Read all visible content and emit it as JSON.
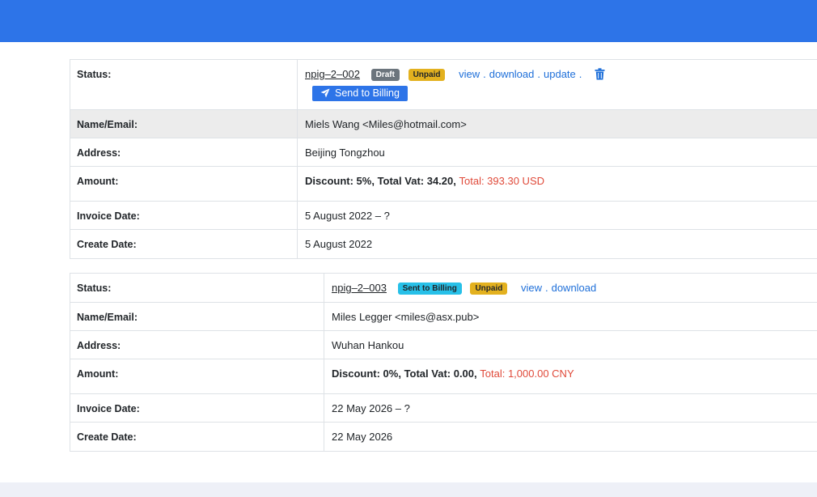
{
  "invoices": [
    {
      "labels": {
        "status": "Status:",
        "name_email": "Name/Email:",
        "address": "Address:",
        "amount": "Amount:",
        "invoice_date": "Invoice Date:",
        "create_date": "Create Date:"
      },
      "number": "npig–2–002",
      "badges": [
        "Draft",
        "Unpaid"
      ],
      "actions": [
        "view",
        "download",
        "update"
      ],
      "send_label": "Send to Billing",
      "name_email": "Miels Wang <Miles@hotmail.com>",
      "address": "Beijing Tongzhou",
      "amount_text": "Discount: 5%, Total Vat: 34.20,",
      "total_text": "Total: 393.30 USD",
      "invoice_date": "5 August 2022 – ?",
      "create_date": "5 August 2022"
    },
    {
      "labels": {
        "status": "Status:",
        "name_email": "Name/Email:",
        "address": "Address:",
        "amount": "Amount:",
        "invoice_date": "Invoice Date:",
        "create_date": "Create Date:"
      },
      "number": "npig–2–003",
      "badges": [
        "Sent to Billing",
        "Unpaid"
      ],
      "actions": [
        "view",
        "download"
      ],
      "name_email": "Miles Legger <miles@asx.pub>",
      "address": "Wuhan Hankou",
      "amount_text": "Discount: 0%, Total Vat: 0.00,",
      "total_text": "Total: 1,000.00 CNY",
      "invoice_date": "22 May 2026 – ?",
      "create_date": "22 May 2026"
    }
  ],
  "colors": {
    "header_bar": "#2d74e8",
    "link": "#1e6fd9",
    "total": "#e04a3a",
    "badge_draft": "#6c757d",
    "badge_unpaid": "#e3b11f",
    "badge_sent": "#27c0e8"
  },
  "icons": {
    "delete": "trash-icon",
    "send": "paper-plane-icon"
  }
}
